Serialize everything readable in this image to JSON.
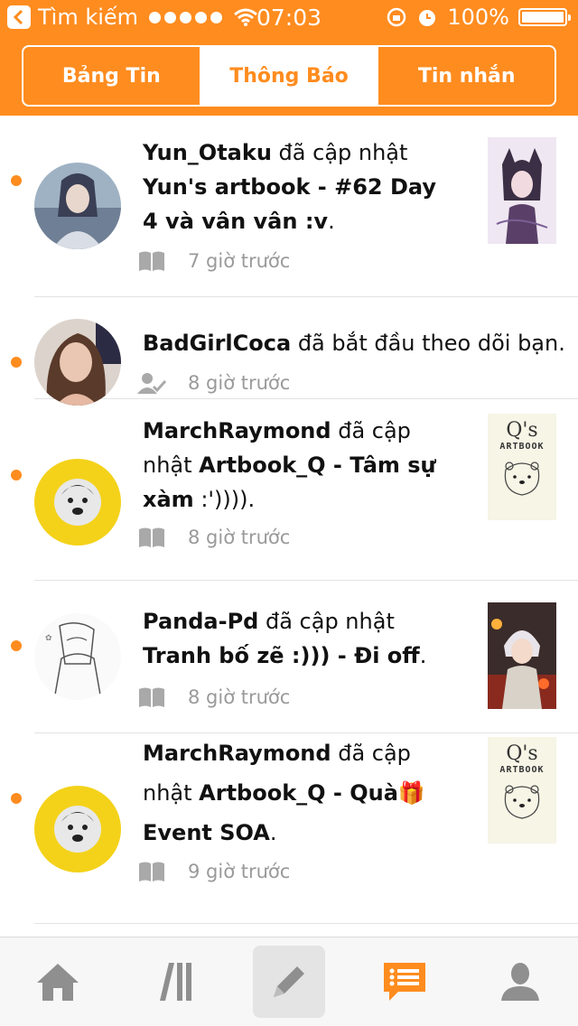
{
  "status_bar": {
    "back_label": "Tìm kiếm",
    "time": "07:03",
    "battery_text": "100%"
  },
  "tabs": [
    {
      "label": "Bảng Tin",
      "active": false
    },
    {
      "label": "Thông Báo",
      "active": true
    },
    {
      "label": "Tin nhắn",
      "active": false
    }
  ],
  "notifications": [
    {
      "user": "Yun_Otaku",
      "action": " đã cập nhật ",
      "target": "Yun's artbook - #62 Day 4 và vân vân :v",
      "suffix": ".",
      "time": "7 giờ trước",
      "meta_icon": "book-icon",
      "unread": true
    },
    {
      "user": "BadGirlCoca",
      "action": " đã bắt đầu theo dõi bạn.",
      "target": "",
      "suffix": "",
      "time": "8 giờ trước",
      "meta_icon": "user-check-icon",
      "unread": true
    },
    {
      "user": "MarchRaymond",
      "action": " đã cập nhật ",
      "target": "Artbook_Q - Tâm sự xàm",
      "suffix": " :')))).",
      "time": "8 giờ trước",
      "meta_icon": "book-icon",
      "unread": true
    },
    {
      "user": "Panda-Pd",
      "action": " đã cập nhật ",
      "target": "Tranh bố zẽ :))) - Đi off",
      "suffix": ".",
      "time": "8 giờ trước",
      "meta_icon": "book-icon",
      "unread": true
    },
    {
      "user": "MarchRaymond",
      "action": " đã cập nhật ",
      "target": "Artbook_Q - Quà🎁 Event SOA",
      "suffix": ".",
      "time": "9 giờ trước",
      "meta_icon": "book-icon",
      "unread": true
    }
  ],
  "thumb_text": {
    "qs": "Q's",
    "artbook": "ARTBOOK"
  },
  "colors": {
    "accent": "#ff8c1f",
    "meta_gray": "#9a9a9a"
  },
  "bottom_tabs": [
    "home-icon",
    "library-icon",
    "compose-icon",
    "notifications-icon",
    "profile-icon"
  ]
}
